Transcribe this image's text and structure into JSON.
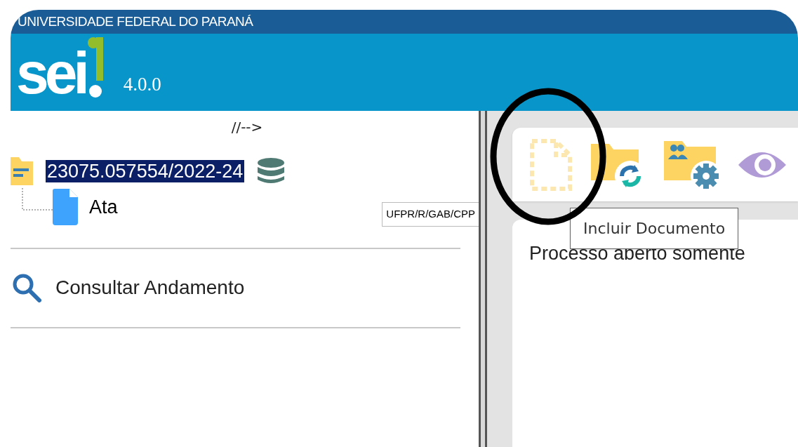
{
  "header": {
    "institution": "UNIVERSIDADE FEDERAL DO PARANÁ",
    "logo": "sei",
    "version": "4.0.0"
  },
  "tree_toggle": "//-->",
  "process": {
    "number": "23075.057554/2022-24",
    "selected": true,
    "children": [
      {
        "label": "Ata",
        "unit": "UFPR/R/GAB/CPP"
      }
    ]
  },
  "menu": [
    {
      "label": "Consultar Andamento"
    }
  ],
  "toolbar": [
    {
      "kind": "new-document"
    },
    {
      "kind": "reopen-folder"
    },
    {
      "kind": "folder-settings"
    },
    {
      "kind": "view"
    }
  ],
  "tooltip": "Incluir Documento",
  "content_text": "Processo aberto somente"
}
